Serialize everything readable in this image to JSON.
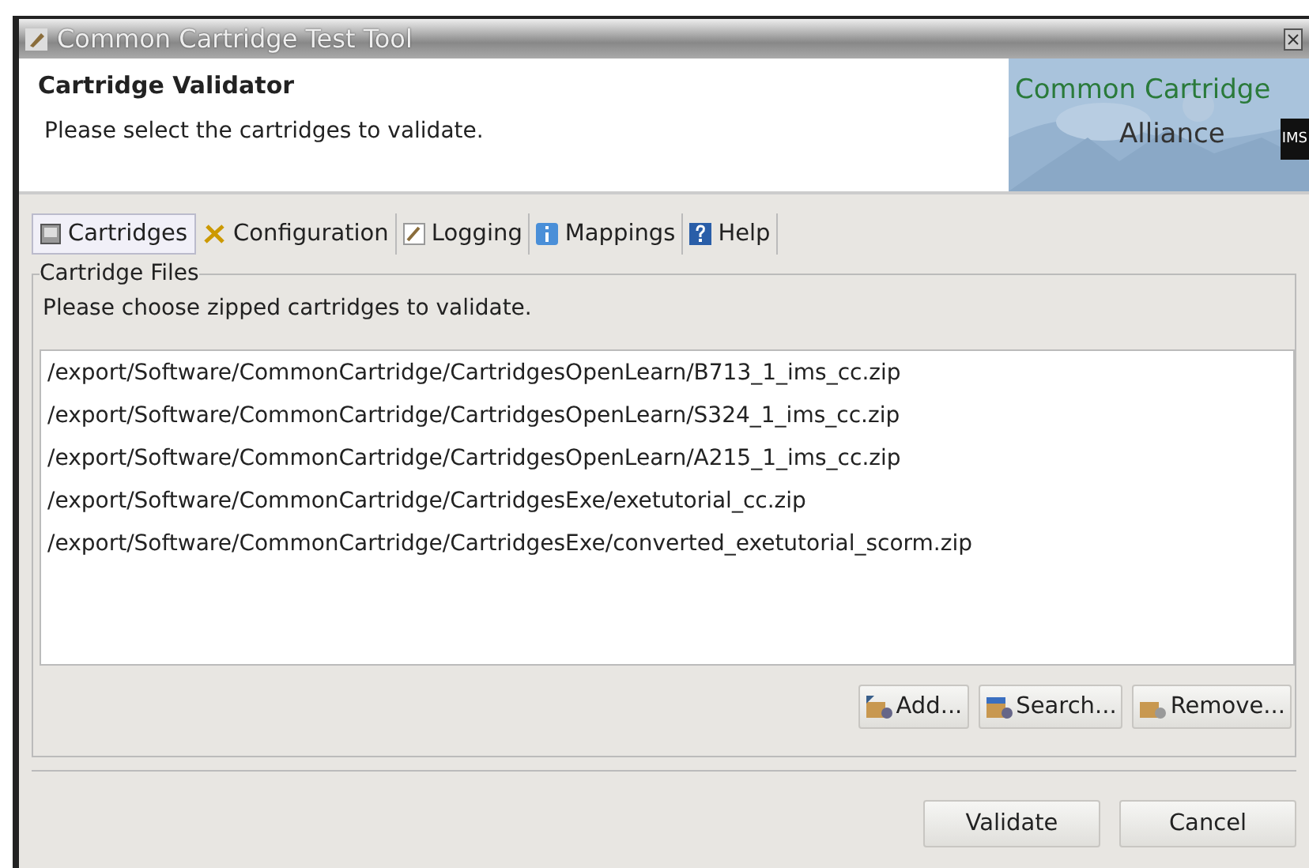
{
  "window": {
    "title": "Common Cartridge Test Tool"
  },
  "header": {
    "title": "Cartridge Validator",
    "subtitle": "Please select the cartridges to validate.",
    "banner": {
      "line_1": "Common Cartridge",
      "line_2": "Alliance",
      "badge": "IMS"
    }
  },
  "tabs": [
    {
      "label": "Cartridges",
      "selected": true
    },
    {
      "label": "Configuration",
      "selected": false
    },
    {
      "label": "Logging",
      "selected": false
    },
    {
      "label": "Mappings",
      "selected": false
    },
    {
      "label": "Help",
      "selected": false
    }
  ],
  "group": {
    "title": "Cartridge Files",
    "description": "Please choose zipped cartridges to validate."
  },
  "files": [
    {
      "path": "/export/Software/CommonCartridge/CartridgesOpenLearn/B713_1_ims_cc.zip",
      "selected": false
    },
    {
      "path": "/export/Software/CommonCartridge/CartridgesOpenLearn/S324_1_ims_cc.zip",
      "selected": false
    },
    {
      "path": "/export/Software/CommonCartridge/CartridgesOpenLearn/A215_1_ims_cc.zip",
      "selected": false
    },
    {
      "path": "/export/Software/CommonCartridge/CartridgesExe/exetutorial_cc.zip",
      "selected": false
    },
    {
      "path": "/export/Software/CommonCartridge/CartridgesExe/converted_exetutorial_scorm.zip",
      "selected": false
    }
  ],
  "file_buttons": [
    "Add...",
    "Search...",
    "Remove..."
  ],
  "buttons": [
    "Validate",
    "Cancel"
  ]
}
